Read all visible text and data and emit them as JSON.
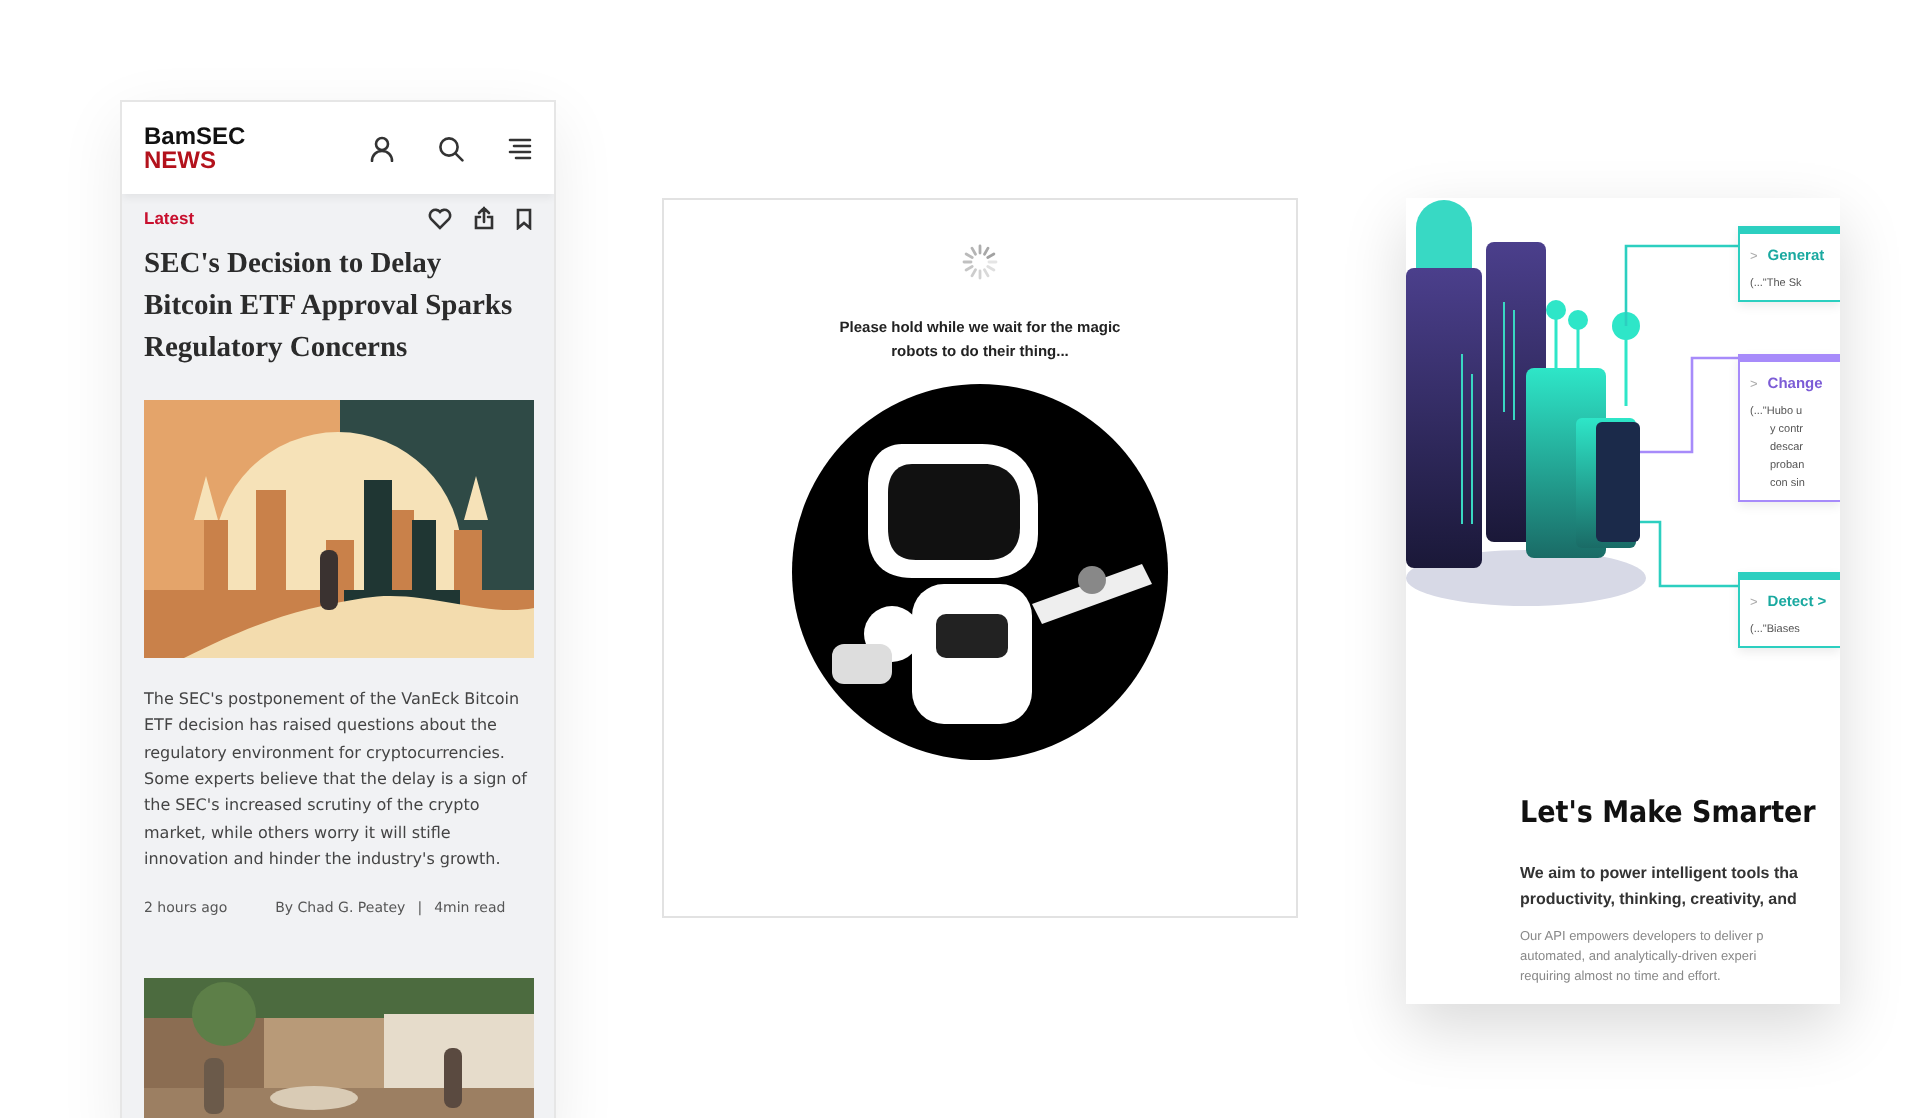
{
  "news_app": {
    "logo": {
      "top": "BamSEC",
      "bottom": "NEWS"
    },
    "article": {
      "tag": "Latest",
      "headline": "SEC's Decision to Delay Bitcoin ETF Approval Sparks Regulatory Concerns",
      "summary": "The SEC's postponement of the VanEck Bitcoin ETF decision has raised questions about the regulatory environment for cryptocurrencies. Some experts believe that the delay is a sign of the SEC's increased scrutiny of the crypto market, while others worry it will stifle innovation and hinder the industry's growth.",
      "time": "2 hours ago",
      "author": "By Chad G. Peatey",
      "separator": "|",
      "read_time": "4min read"
    }
  },
  "loading_card": {
    "message": "Please hold while we wait for the magic robots to do their thing..."
  },
  "api_card": {
    "panels": [
      {
        "prompt": ">",
        "label": "Generat",
        "color": "#2ccfc0",
        "snippet": [
          "(...\"The Sk"
        ]
      },
      {
        "prompt": ">",
        "label": "Change",
        "color": "#a78bfa",
        "snippet": [
          "(...\"Hubo u",
          "y contr",
          "descar",
          "proban",
          "con sin"
        ]
      },
      {
        "prompt": ">",
        "label": "Detect >",
        "color": "#2ccfc0",
        "snippet": [
          "(...\"Biases"
        ]
      }
    ],
    "heading": "Let's Make Smarter",
    "lead_lines": [
      "We aim to power intelligent tools tha",
      "productivity, thinking, creativity, and"
    ],
    "body_lines": [
      "Our API empowers developers to deliver p",
      "automated, and analytically-driven experi",
      "requiring almost no time and effort."
    ]
  }
}
